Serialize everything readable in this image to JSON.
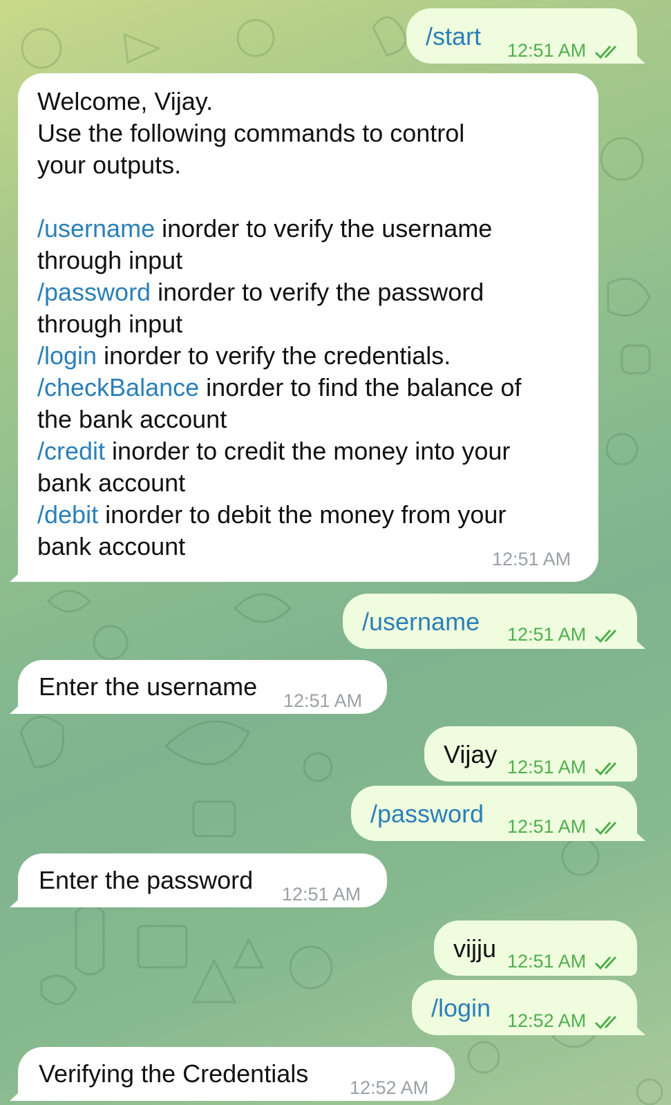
{
  "messages": [
    {
      "id": "m1",
      "dir": "out",
      "text": "/start",
      "time": "12:51 AM"
    },
    {
      "id": "m2",
      "dir": "in",
      "time": "12:51 AM",
      "lines": [
        [
          {
            "t": "Welcome, Vijay."
          }
        ],
        [
          {
            "t": "Use the following commands to control"
          }
        ],
        [
          {
            "t": "your outputs."
          }
        ],
        [
          {
            "t": ""
          }
        ],
        [
          {
            "t": "/username",
            "cmd": true
          },
          {
            "t": " inorder to verify the username"
          }
        ],
        [
          {
            "t": "through input"
          }
        ],
        [
          {
            "t": "/password",
            "cmd": true
          },
          {
            "t": " inorder to verify the password"
          }
        ],
        [
          {
            "t": "through input"
          }
        ],
        [
          {
            "t": "/login",
            "cmd": true
          },
          {
            "t": " inorder to verify the credentials."
          }
        ],
        [
          {
            "t": "/checkBalance",
            "cmd": true
          },
          {
            "t": " inorder to find the balance of"
          }
        ],
        [
          {
            "t": "the bank account"
          }
        ],
        [
          {
            "t": "/credit",
            "cmd": true
          },
          {
            "t": " inorder to credit the money into your"
          }
        ],
        [
          {
            "t": "bank account"
          }
        ],
        [
          {
            "t": "/debit",
            "cmd": true
          },
          {
            "t": " inorder to debit the money from your"
          }
        ],
        [
          {
            "t": "bank account"
          }
        ]
      ]
    },
    {
      "id": "m3",
      "dir": "out",
      "text": "/username",
      "time": "12:51 AM"
    },
    {
      "id": "m4",
      "dir": "in",
      "text": "Enter the username",
      "time": "12:51 AM"
    },
    {
      "id": "m5",
      "dir": "out",
      "text": "Vijay",
      "time": "12:51 AM"
    },
    {
      "id": "m6",
      "dir": "out",
      "text": "/password",
      "time": "12:51 AM"
    },
    {
      "id": "m7",
      "dir": "in",
      "text": "Enter the password",
      "time": "12:51 AM"
    },
    {
      "id": "m8",
      "dir": "out",
      "text": "vijju",
      "time": "12:51 AM"
    },
    {
      "id": "m9",
      "dir": "out",
      "text": "/login",
      "time": "12:52 AM"
    },
    {
      "id": "m10",
      "dir": "in",
      "text": "Verifying the Credentials",
      "time": "12:52 AM"
    }
  ],
  "colors": {
    "outgoing_bubble": "#effdde",
    "incoming_bubble": "#ffffff",
    "command_link": "#2a7fb8",
    "outgoing_time": "#4fae4e",
    "incoming_time": "#9aa0a6"
  },
  "icons": {
    "read_receipt": "double-check-icon"
  }
}
